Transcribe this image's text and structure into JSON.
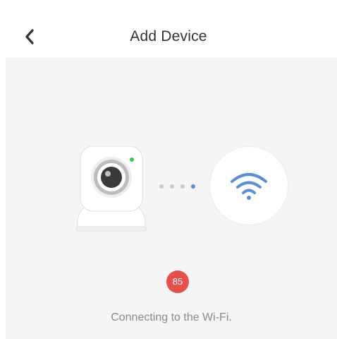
{
  "header": {
    "title": "Add Device",
    "back_icon": "chevron-left-icon"
  },
  "illustration": {
    "device_icon": "camera-icon",
    "network_icon": "wifi-icon",
    "dots_total": 4,
    "dots_active": 1
  },
  "progress": {
    "value": "85"
  },
  "status": {
    "message": "Connecting to the Wi-Fi."
  },
  "colors": {
    "accent": "#5a8fd6",
    "badge": "#e5504b",
    "indicator_led": "#3cc44f",
    "background": "#f5f5f5"
  }
}
